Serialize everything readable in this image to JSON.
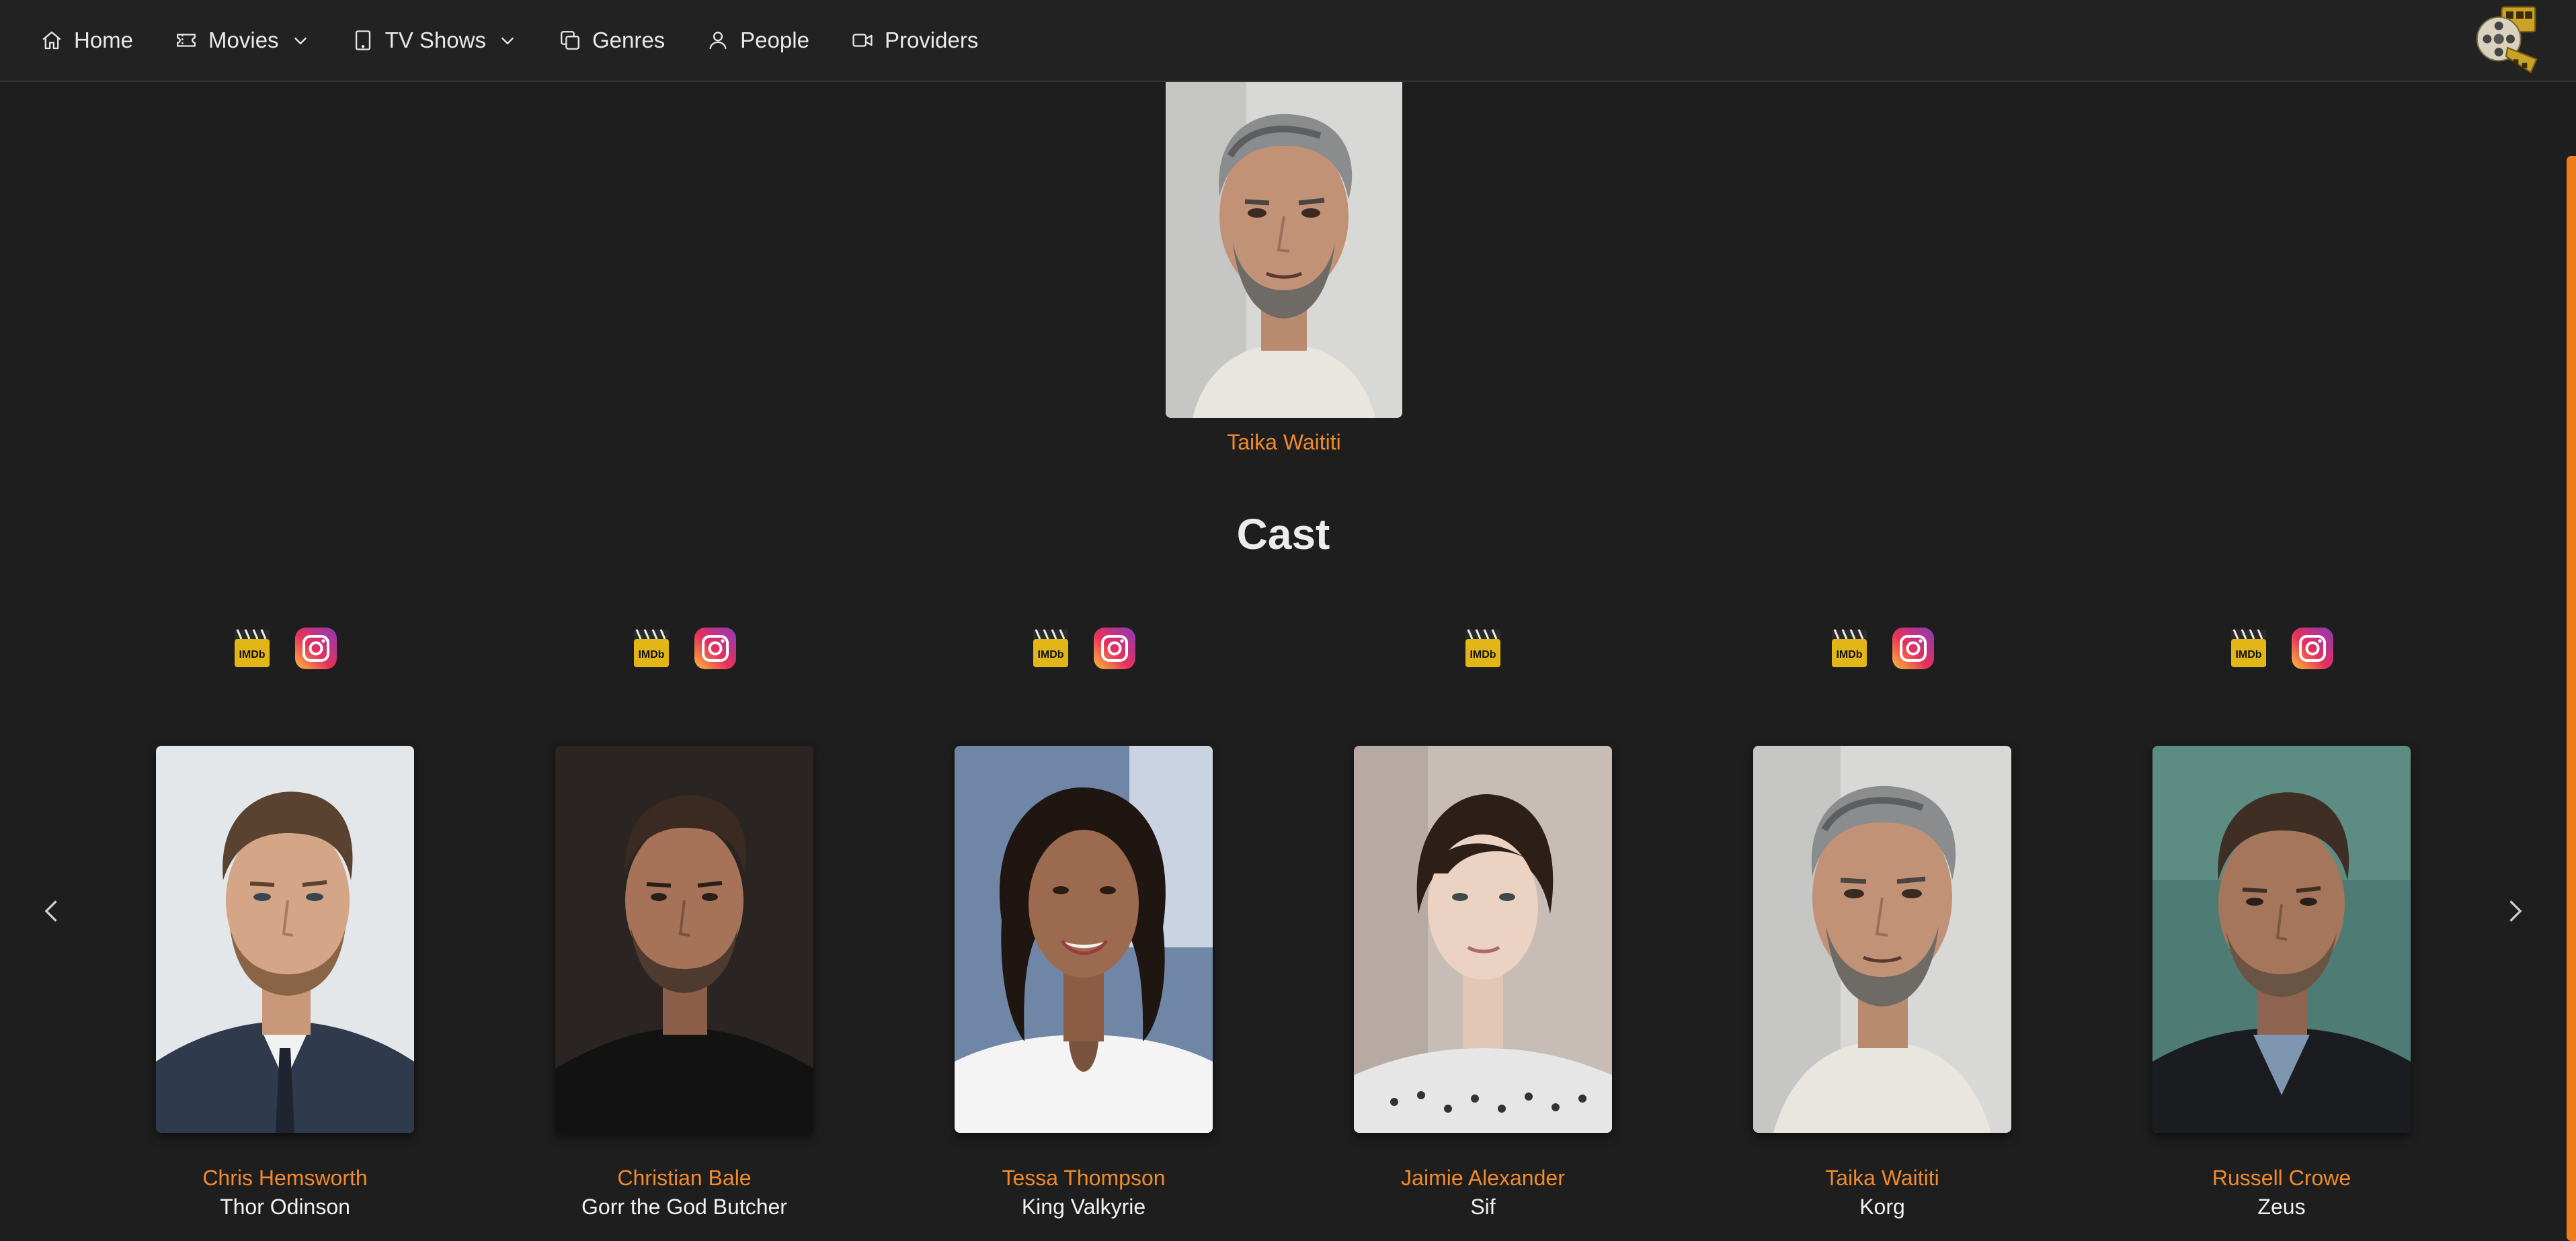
{
  "nav": {
    "items": [
      {
        "label": "Home",
        "icon": "home-icon"
      },
      {
        "label": "Movies",
        "icon": "ticket-icon",
        "dropdown": true
      },
      {
        "label": "TV Shows",
        "icon": "tablet-icon",
        "dropdown": true
      },
      {
        "label": "Genres",
        "icon": "copy-icon"
      },
      {
        "label": "People",
        "icon": "person-icon"
      },
      {
        "label": "Providers",
        "icon": "video-icon"
      }
    ],
    "logo": "film-reel-logo"
  },
  "director": {
    "name": "Taika Waititi"
  },
  "cast": {
    "title": "Cast",
    "members": [
      {
        "name": "Chris Hemsworth",
        "role": "Thor Odinson",
        "imdb": true,
        "instagram": true
      },
      {
        "name": "Christian Bale",
        "role": "Gorr the God Butcher",
        "imdb": true,
        "instagram": true
      },
      {
        "name": "Tessa Thompson",
        "role": "King Valkyrie",
        "imdb": true,
        "instagram": true
      },
      {
        "name": "Jaimie Alexander",
        "role": "Sif",
        "imdb": true,
        "instagram": false
      },
      {
        "name": "Taika Waititi",
        "role": "Korg",
        "imdb": true,
        "instagram": true
      },
      {
        "name": "Russell Crowe",
        "role": "Zeus",
        "imdb": true,
        "instagram": true
      }
    ]
  },
  "badges": {
    "imdb_text": "IMDb"
  },
  "colors": {
    "background": "#1e1e1e",
    "navbar": "#222222",
    "accent": "#f08a2a",
    "scrollbar": "#f07d1a"
  }
}
